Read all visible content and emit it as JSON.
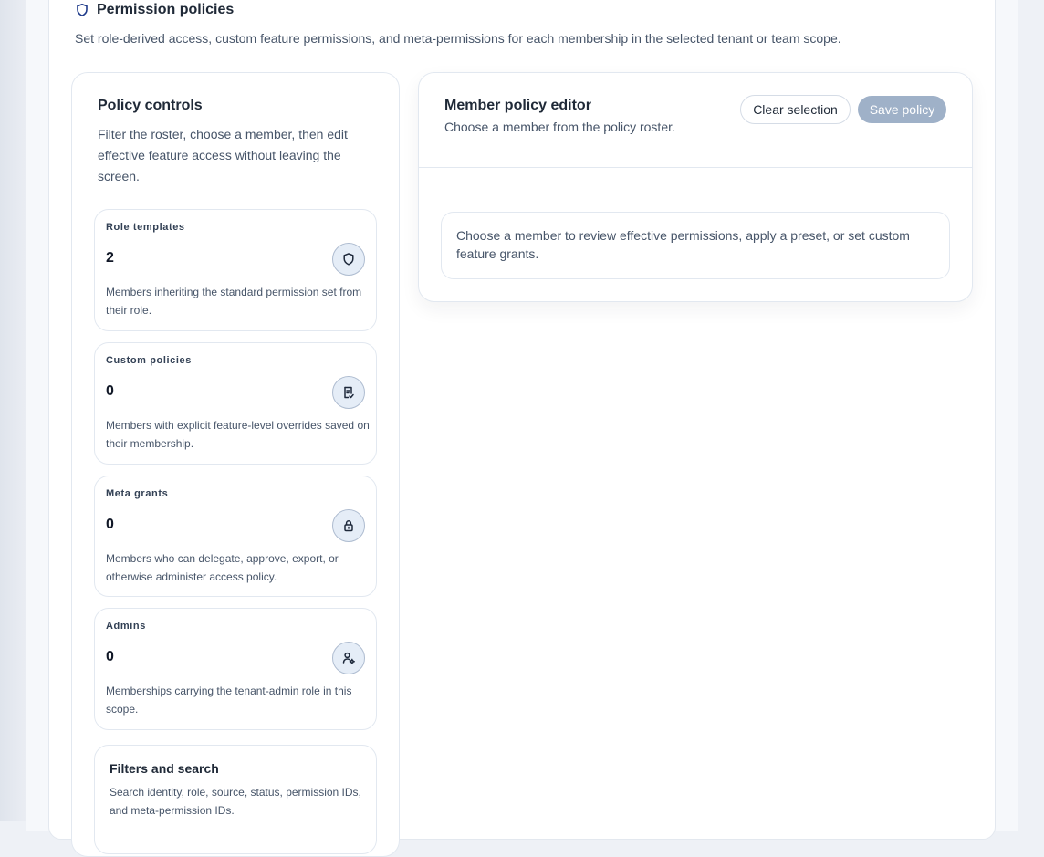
{
  "section": {
    "title": "Permission policies",
    "icon": "shield-icon",
    "description": "Set role-derived access, custom feature permissions, and meta-permissions for each membership in the selected tenant or team scope."
  },
  "policy_controls": {
    "title": "Policy controls",
    "description": "Filter the roster, choose a member, then edit effective feature access without leaving the screen.",
    "stats": [
      {
        "label": "Role templates",
        "value": "2",
        "icon": "shield-icon",
        "description": "Members inheriting the standard permission set from their role."
      },
      {
        "label": "Custom policies",
        "value": "0",
        "icon": "document-check-icon",
        "description": "Members with explicit feature-level overrides saved on their membership."
      },
      {
        "label": "Meta grants",
        "value": "0",
        "icon": "lock-icon",
        "description": "Members who can delegate, approve, export, or otherwise administer access policy."
      },
      {
        "label": "Admins",
        "value": "0",
        "icon": "user-gear-icon",
        "description": "Memberships carrying the tenant-admin role in this scope."
      }
    ],
    "filters": {
      "title": "Filters and search",
      "description": "Search identity, role, source, status, permission IDs, and meta-permission IDs."
    }
  },
  "editor": {
    "title": "Member policy editor",
    "subtitle": "Choose a member from the policy roster.",
    "clear_label": "Clear selection",
    "save_label": "Save policy",
    "save_disabled": true,
    "empty_state": "Choose a member to review effective permissions, apply a preset, or set custom feature grants."
  },
  "colors": {
    "accent": "#1e3a8a",
    "icon_bg": "#e5edf7",
    "save_disabled_bg": "#9fb1c8"
  }
}
